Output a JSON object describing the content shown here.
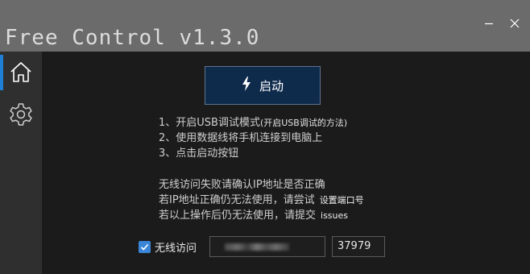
{
  "window": {
    "title": "Free Control v1.3.0",
    "minimize_icon": "minimize-icon",
    "close_icon": "close-icon"
  },
  "sidebar": {
    "items": [
      {
        "icon": "home-icon",
        "active": true
      },
      {
        "icon": "gear-icon",
        "active": false
      }
    ]
  },
  "main": {
    "start_button": {
      "icon": "lightning-icon",
      "label": "启动"
    },
    "steps": [
      {
        "text": "1、开启USB调试模式",
        "link": "(开启USB调试的方法)"
      },
      {
        "text": "2、使用数据线将手机连接到电脑上"
      },
      {
        "text": "3、点击启动按钮"
      }
    ],
    "tips": [
      {
        "text": "无线访问失败请确认IP地址是否正确"
      },
      {
        "text": "若IP地址正确仍无法使用，请尝试",
        "link": "设置端口号"
      },
      {
        "text": "若以上操作后仍无法使用，请提交",
        "link": "issues"
      }
    ],
    "wireless": {
      "checked": true,
      "label": "无线访问",
      "ip_value": "",
      "port_value": "37979"
    }
  },
  "colors": {
    "title_bar": "#6b6b6b",
    "sidebar": "#2f2f2f",
    "background": "#1b1b1b",
    "accent": "#1d7fd6",
    "start_button": "#0f2b4c",
    "checkbox": "#3a85d8"
  }
}
